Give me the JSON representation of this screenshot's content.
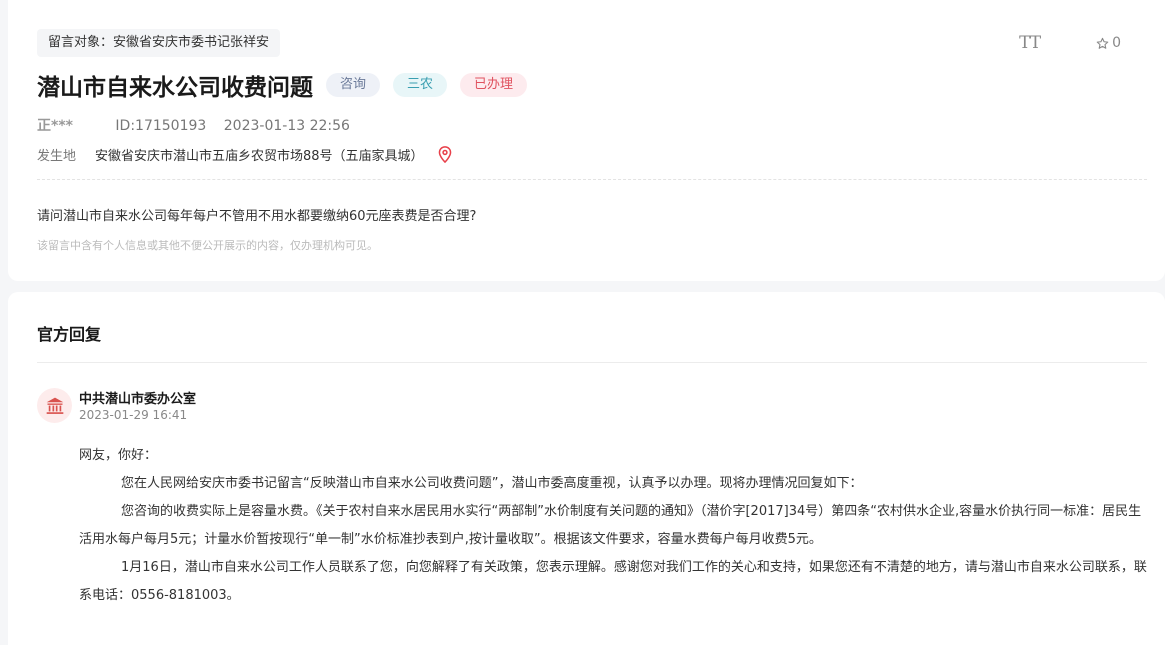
{
  "message": {
    "target_chip": "留言对象：安徽省安庆市委书记张祥安",
    "title": "潜山市自来水公司收费问题",
    "tags": [
      "咨询",
      "三农",
      "已办理"
    ],
    "author": "正***",
    "id_text": "ID:17150193",
    "datetime": "2023-01-13 22:56",
    "location_label": "发生地",
    "location_value": "安徽省安庆市潜山市五庙乡农贸市场88号（五庙家具城）",
    "question": "请问潜山市自来水公司每年每户不管用不用水都要缴纳60元座表费是否合理?",
    "notice": "该留言中含有个人信息或其他不便公开展示的内容，仅办理机构可见。"
  },
  "toolbar": {
    "font_size_glyph": "TT",
    "favorite_count": "0"
  },
  "reply": {
    "heading": "官方回复",
    "org_name": "中共潜山市委办公室",
    "time": "2023-01-29 16:41",
    "greeting": "网友，你好：",
    "paragraphs": [
      "您在人民网给安庆市委书记留言“反映潜山市自来水公司收费问题”，潜山市委高度重视，认真予以办理。现将办理情况回复如下：",
      "您咨询的收费实际上是容量水费。《关于农村自来水居民用水实行“两部制”水价制度有关问题的通知》（潜价字[2017]34号）第四条“农村供水企业,容量水价执行同一标准：居民生活用水每户每月5元；计量水价暂按现行“单一制”水价标准抄表到户,按计量收取”。根据该文件要求，容量水费每户每月收费5元。",
      " 1月16日，潜山市自来水公司工作人员联系了您，向您解释了有关政策，您表示理解。感谢您对我们工作的关心和支持，如果您还有不清楚的地方，请与潜山市自来水公司联系，联系电话：0556-8181003。"
    ]
  },
  "icons": {
    "font_size": "font-size-icon",
    "favorite": "star-outline-icon",
    "location": "map-pin-icon",
    "org": "government-building-icon"
  },
  "colors": {
    "tag_consult": "#6b7a99",
    "tag_agri": "#3a9fb1",
    "tag_done": "#e0525f",
    "location_pin": "#e8404a",
    "org_icon": "#d9534f"
  }
}
